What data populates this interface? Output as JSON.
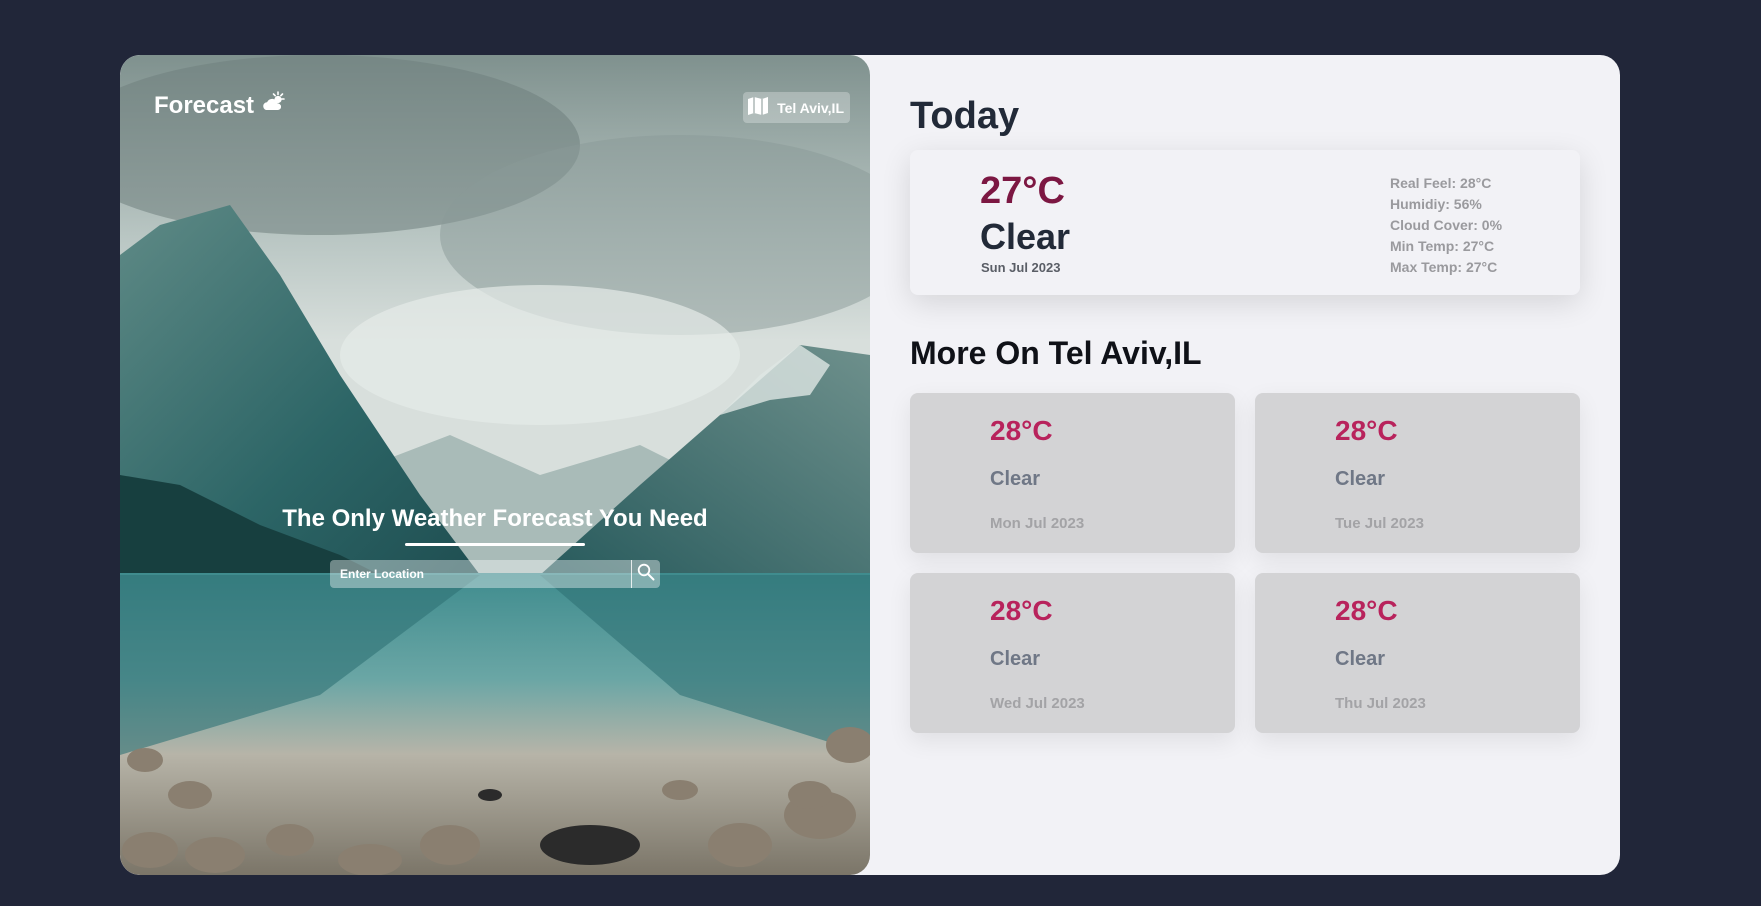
{
  "brand": {
    "title": "Forecast",
    "icon": "cloud-sun-icon"
  },
  "location_badge": {
    "label": "Tel Aviv,IL",
    "icon": "map-icon"
  },
  "hero": {
    "tagline": "The Only Weather Forecast You Need",
    "search": {
      "placeholder": "Enter Location",
      "icon": "search-icon"
    }
  },
  "today": {
    "heading": "Today",
    "temp": "27°C",
    "condition": "Clear",
    "date": "Sun Jul 2023",
    "details": [
      "Real Feel: 28°C",
      "Humidiy: 56%",
      "Cloud Cover: 0%",
      "Min Temp: 27°C",
      "Max Temp: 27°C"
    ]
  },
  "more": {
    "heading": "More On Tel Aviv,IL",
    "days": [
      {
        "temp": "28°C",
        "condition": "Clear",
        "date": "Mon Jul 2023"
      },
      {
        "temp": "28°C",
        "condition": "Clear",
        "date": "Tue Jul 2023"
      },
      {
        "temp": "28°C",
        "condition": "Clear",
        "date": "Wed Jul 2023"
      },
      {
        "temp": "28°C",
        "condition": "Clear",
        "date": "Thu Jul 2023"
      }
    ]
  },
  "colors": {
    "page_bg": "#212639",
    "panel_bg": "#f2f2f6",
    "today_temp": "#7c1742",
    "forecast_temp": "#b8235c",
    "forecast_card_bg": "#d3d3d5"
  }
}
